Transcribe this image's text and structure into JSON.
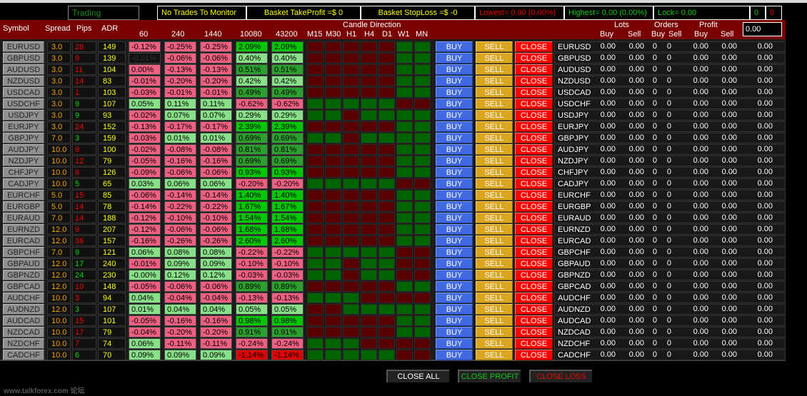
{
  "colors": {
    "header_bg": "#7a0000",
    "neg": "#f06080",
    "pos": "#88e088",
    "strong_pos": "#00c800",
    "mid_pos": "#2ca02c",
    "strong_neg": "#e00000",
    "flat": "#111111",
    "candle_up": "#006400",
    "candle_down": "#5a0000"
  },
  "status": {
    "trading": "Trading",
    "monitor": "No Trades To Monitor",
    "basket_tp": "Basket TakeProfit =$ 0",
    "basket_sl": "Basket StopLoss =$ -0",
    "lowest": "Lowest= 0.00 (0.00%)",
    "highest": "Highest= 0.00 (0.00%)",
    "lock": "Lock= 0.00",
    "count_green": "0",
    "count_red": "0"
  },
  "header": {
    "symbol": "Symbol",
    "spread": "Spread",
    "pips": "Pips",
    "adr": "ADR",
    "periods": [
      "60",
      "240",
      "1440",
      "10080",
      "43200"
    ],
    "candle_direction": "Candle Direction",
    "tfs": [
      "M15",
      "M30",
      "H1",
      "H4",
      "D1",
      "W1",
      "MN"
    ],
    "lots": "Lots",
    "orders": "Orders",
    "profit": "Profit",
    "buy": "Buy",
    "sell": "Sell",
    "total_input": "0.00"
  },
  "buttons": {
    "buy": "BUY",
    "sell": "SELL",
    "close": "CLOSE",
    "close_all": "CLOSE ALL",
    "close_profit": "CLOSE PROFIT",
    "close_loss": "CLOSE LOSS"
  },
  "watermark": "www.talkforex.com 论坛",
  "rows": [
    {
      "symbol": "EURUSD",
      "spread": "3.0",
      "pips": "28",
      "pips_up": false,
      "adr": "149",
      "pct": [
        "-0.12%",
        "-0.25%",
        "-0.25%",
        "2.09%",
        "2.09%"
      ],
      "heat": "nnngg",
      "candles": "DDDDDUU"
    },
    {
      "symbol": "GBPUSD",
      "spread": "3.0",
      "pips": "9",
      "pips_up": false,
      "adr": "139",
      "pct": [
        "-0.01%",
        "-0.06%",
        "-0.06%",
        "0.40%",
        "0.40%"
      ],
      "heat": "knnpp",
      "candles": "DDDDDUU"
    },
    {
      "symbol": "AUDUSD",
      "spread": "3.0",
      "pips": "11",
      "pips_up": false,
      "adr": "104",
      "pct": [
        "0.00%",
        "-0.13%",
        "-0.13%",
        "0.51%",
        "0.51%"
      ],
      "heat": "nnndd",
      "candles": "DDDDDUU"
    },
    {
      "symbol": "NZDUSD",
      "spread": "3.0",
      "pips": "14",
      "pips_up": false,
      "adr": "83",
      "pct": [
        "-0.01%",
        "-0.20%",
        "-0.20%",
        "0.42%",
        "0.42%"
      ],
      "heat": "nnnpp",
      "candles": "DDDDDUU"
    },
    {
      "symbol": "USDCAD",
      "spread": "3.0",
      "pips": "1",
      "pips_up": false,
      "adr": "103",
      "pct": [
        "-0.03%",
        "-0.01%",
        "-0.01%",
        "0.49%",
        "0.49%"
      ],
      "heat": "nnndd",
      "candles": "DDDDDUU"
    },
    {
      "symbol": "USDCHF",
      "spread": "3.0",
      "pips": "9",
      "pips_up": true,
      "adr": "107",
      "pct": [
        "0.05%",
        "0.11%",
        "0.11%",
        "-0.62%",
        "-0.62%"
      ],
      "heat": "pppnn",
      "candles": "UUUUUDD"
    },
    {
      "symbol": "USDJPY",
      "spread": "3.0",
      "pips": "9",
      "pips_up": true,
      "adr": "93",
      "pct": [
        "-0.02%",
        "0.07%",
        "0.07%",
        "0.29%",
        "0.29%"
      ],
      "heat": "npppp",
      "candles": "UUDUUUU"
    },
    {
      "symbol": "EURJPY",
      "spread": "3.0",
      "pips": "24",
      "pips_up": false,
      "adr": "152",
      "pct": [
        "-0.13%",
        "-0.17%",
        "-0.17%",
        "2.39%",
        "2.39%"
      ],
      "heat": "nnngg",
      "candles": "DDDDDUU"
    },
    {
      "symbol": "GBPJPY",
      "spread": "7.0",
      "pips": "3",
      "pips_up": true,
      "adr": "159",
      "pct": [
        "-0.03%",
        "0.01%",
        "0.01%",
        "0.69%",
        "0.69%"
      ],
      "heat": "nppdd",
      "candles": "UUDUUUU"
    },
    {
      "symbol": "AUDJPY",
      "spread": "10.0",
      "pips": "9",
      "pips_up": false,
      "adr": "100",
      "pct": [
        "-0.02%",
        "-0.08%",
        "-0.08%",
        "0.81%",
        "0.81%"
      ],
      "heat": "nnndd",
      "candles": "DDDDDUU"
    },
    {
      "symbol": "NZDJPY",
      "spread": "10.0",
      "pips": "12",
      "pips_up": false,
      "adr": "79",
      "pct": [
        "-0.05%",
        "-0.16%",
        "-0.16%",
        "0.69%",
        "0.69%"
      ],
      "heat": "nnndd",
      "candles": "DDDDDUU"
    },
    {
      "symbol": "CHFJPY",
      "spread": "10.0",
      "pips": "6",
      "pips_up": false,
      "adr": "126",
      "pct": [
        "-0.09%",
        "-0.06%",
        "-0.06%",
        "0.93%",
        "0.93%"
      ],
      "heat": "nnngg",
      "candles": "DDDDDUU"
    },
    {
      "symbol": "CADJPY",
      "spread": "10.0",
      "pips": "5",
      "pips_up": true,
      "adr": "65",
      "pct": [
        "0.03%",
        "0.06%",
        "0.06%",
        "-0.20%",
        "-0.20%"
      ],
      "heat": "pppnn",
      "candles": "UUUUUDD"
    },
    {
      "symbol": "EURCHF",
      "spread": "5.0",
      "pips": "15",
      "pips_up": false,
      "adr": "85",
      "pct": [
        "-0.06%",
        "-0.14%",
        "-0.14%",
        "1.40%",
        "1.40%"
      ],
      "heat": "nnngg",
      "candles": "DDDDDUU"
    },
    {
      "symbol": "EURGBP",
      "spread": "5.0",
      "pips": "14",
      "pips_up": false,
      "adr": "78",
      "pct": [
        "-0.14%",
        "-0.22%",
        "-0.22%",
        "1.67%",
        "1.67%"
      ],
      "heat": "nnngg",
      "candles": "DDDDDUU"
    },
    {
      "symbol": "EURAUD",
      "spread": "7.0",
      "pips": "14",
      "pips_up": false,
      "adr": "188",
      "pct": [
        "-0.12%",
        "-0.10%",
        "-0.10%",
        "1.54%",
        "1.54%"
      ],
      "heat": "nnngg",
      "candles": "DDDDDUU"
    },
    {
      "symbol": "EURNZD",
      "spread": "12.0",
      "pips": "9",
      "pips_up": false,
      "adr": "207",
      "pct": [
        "-0.12%",
        "-0.06%",
        "-0.06%",
        "1.68%",
        "1.68%"
      ],
      "heat": "nnngg",
      "candles": "DDDDDUU"
    },
    {
      "symbol": "EURCAD",
      "spread": "12.0",
      "pips": "36",
      "pips_up": false,
      "adr": "157",
      "pct": [
        "-0.16%",
        "-0.26%",
        "-0.26%",
        "2.60%",
        "2.60%"
      ],
      "heat": "nnngg",
      "candles": "DDDDDUU"
    },
    {
      "symbol": "GBPCHF",
      "spread": "7.0",
      "pips": "9",
      "pips_up": true,
      "adr": "121",
      "pct": [
        "0.06%",
        "0.08%",
        "0.08%",
        "-0.22%",
        "-0.22%"
      ],
      "heat": "pppnn",
      "candles": "UUUUUDD"
    },
    {
      "symbol": "GBPAUD",
      "spread": "12.0",
      "pips": "17",
      "pips_up": true,
      "adr": "240",
      "pct": [
        "-0.01%",
        "0.09%",
        "0.09%",
        "-0.10%",
        "-0.10%"
      ],
      "heat": "nppnn",
      "candles": "UUDUUDD"
    },
    {
      "symbol": "GBPNZD",
      "spread": "12.0",
      "pips": "24",
      "pips_up": true,
      "adr": "230",
      "pct": [
        "-0.00%",
        "0.12%",
        "0.12%",
        "-0.03%",
        "-0.03%"
      ],
      "heat": "pppnn",
      "candles": "UUDUUDD"
    },
    {
      "symbol": "GBPCAD",
      "spread": "12.0",
      "pips": "10",
      "pips_up": false,
      "adr": "148",
      "pct": [
        "-0.05%",
        "-0.06%",
        "-0.06%",
        "0.89%",
        "0.89%"
      ],
      "heat": "nnndd",
      "candles": "DDDDDUU"
    },
    {
      "symbol": "AUDCHF",
      "spread": "10.0",
      "pips": "3",
      "pips_up": false,
      "adr": "94",
      "pct": [
        "0.04%",
        "-0.04%",
        "-0.04%",
        "-0.13%",
        "-0.13%"
      ],
      "heat": "pnnnn",
      "candles": "UUUDDDD"
    },
    {
      "symbol": "AUDNZD",
      "spread": "12.0",
      "pips": "3",
      "pips_up": true,
      "adr": "107",
      "pct": [
        "0.01%",
        "0.04%",
        "0.04%",
        "0.05%",
        "0.05%"
      ],
      "heat": "ppppp",
      "candles": "DDUUUUU"
    },
    {
      "symbol": "AUDCAD",
      "spread": "10.0",
      "pips": "15",
      "pips_up": false,
      "adr": "101",
      "pct": [
        "-0.05%",
        "-0.16%",
        "-0.16%",
        "0.98%",
        "0.98%"
      ],
      "heat": "nnngg",
      "candles": "DDDDDUU"
    },
    {
      "symbol": "NZDCAD",
      "spread": "10.0",
      "pips": "17",
      "pips_up": false,
      "adr": "79",
      "pct": [
        "-0.04%",
        "-0.20%",
        "-0.20%",
        "0.91%",
        "0.91%"
      ],
      "heat": "nnndd",
      "candles": "DDDDDUU"
    },
    {
      "symbol": "NZDCHF",
      "spread": "10.0",
      "pips": "7",
      "pips_up": false,
      "adr": "74",
      "pct": [
        "0.06%",
        "-0.11%",
        "-0.11%",
        "-0.24%",
        "-0.24%"
      ],
      "heat": "pnnnn",
      "candles": "UUUDDDD"
    },
    {
      "symbol": "CADCHF",
      "spread": "10.0",
      "pips": "6",
      "pips_up": true,
      "adr": "70",
      "pct": [
        "0.09%",
        "0.09%",
        "0.09%",
        "-1.14%",
        "-1.14%"
      ],
      "heat": "pppr r",
      "candles": "UUUUUDD"
    }
  ],
  "row_values": {
    "lots_buy": "0.00",
    "lots_sell": "0.00",
    "orders_buy": "0",
    "orders_sell": "0",
    "profit_buy": "0.00",
    "profit_sell": "0.00",
    "total": "0.00"
  }
}
